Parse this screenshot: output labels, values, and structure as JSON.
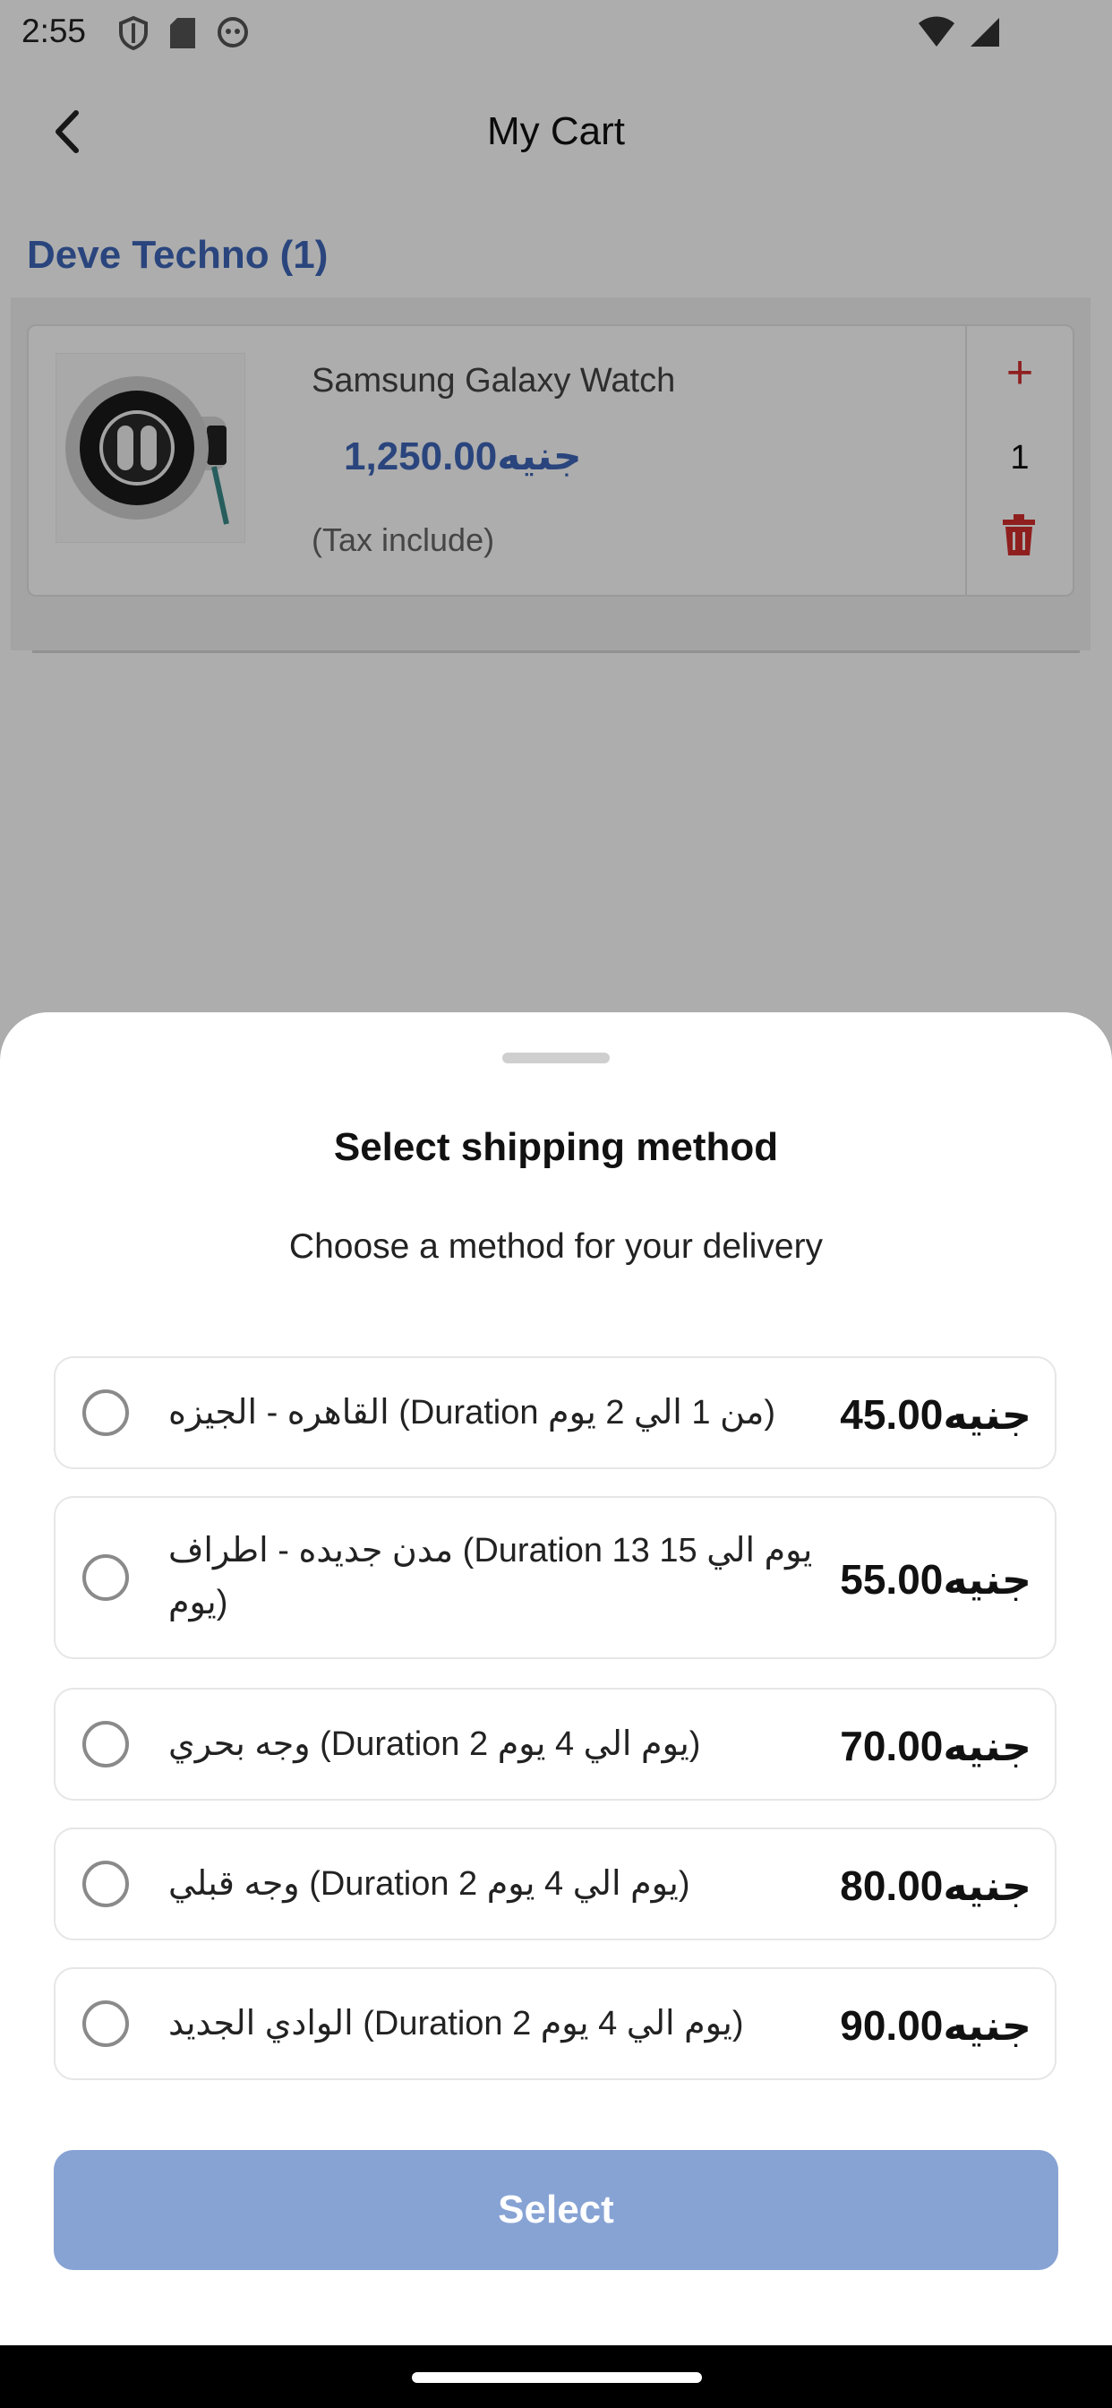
{
  "status_bar": {
    "time": "2:55",
    "left_icons": [
      "shield-icon",
      "sd-card-icon",
      "robot-icon"
    ],
    "right_icons": [
      "wifi-icon",
      "signal-icon"
    ]
  },
  "app_bar": {
    "title": "My Cart",
    "back_icon": "chevron-left-icon"
  },
  "cart": {
    "store_name": "Deve Techno",
    "store_count": "(1)",
    "items": [
      {
        "name": "Samsung Galaxy Watch",
        "price": "1,250.00جنيه",
        "tax_note": "(Tax include)",
        "quantity": "1",
        "plus_label": "+",
        "delete_icon": "trash-icon",
        "accent": "#d32f2f"
      }
    ]
  },
  "sheet": {
    "title": "Select shipping method",
    "subtitle": "Choose a method for your delivery",
    "options": [
      {
        "label": "القاهره - الجيزه (Duration من 1 الي 2 يوم)",
        "price": "45.00جنيه",
        "selected": false
      },
      {
        "label": "مدن جديده - اطراف (Duration 13 يوم الي 15 يوم)",
        "price": "55.00جنيه",
        "selected": false
      },
      {
        "label": "وجه بحري (Duration 2 يوم الي 4 يوم)",
        "price": "70.00جنيه",
        "selected": false
      },
      {
        "label": "وجه قبلي (Duration 2 يوم الي 4 يوم)",
        "price": "80.00جنيه",
        "selected": false
      },
      {
        "label": "الوادي الجديد (Duration 2 يوم الي 4 يوم)",
        "price": "90.00جنيه",
        "selected": false
      }
    ],
    "select_button": "Select",
    "button_color": "#87a3d4"
  },
  "colors": {
    "brand_blue": "#3f66b8",
    "danger_red": "#d32f2f"
  }
}
